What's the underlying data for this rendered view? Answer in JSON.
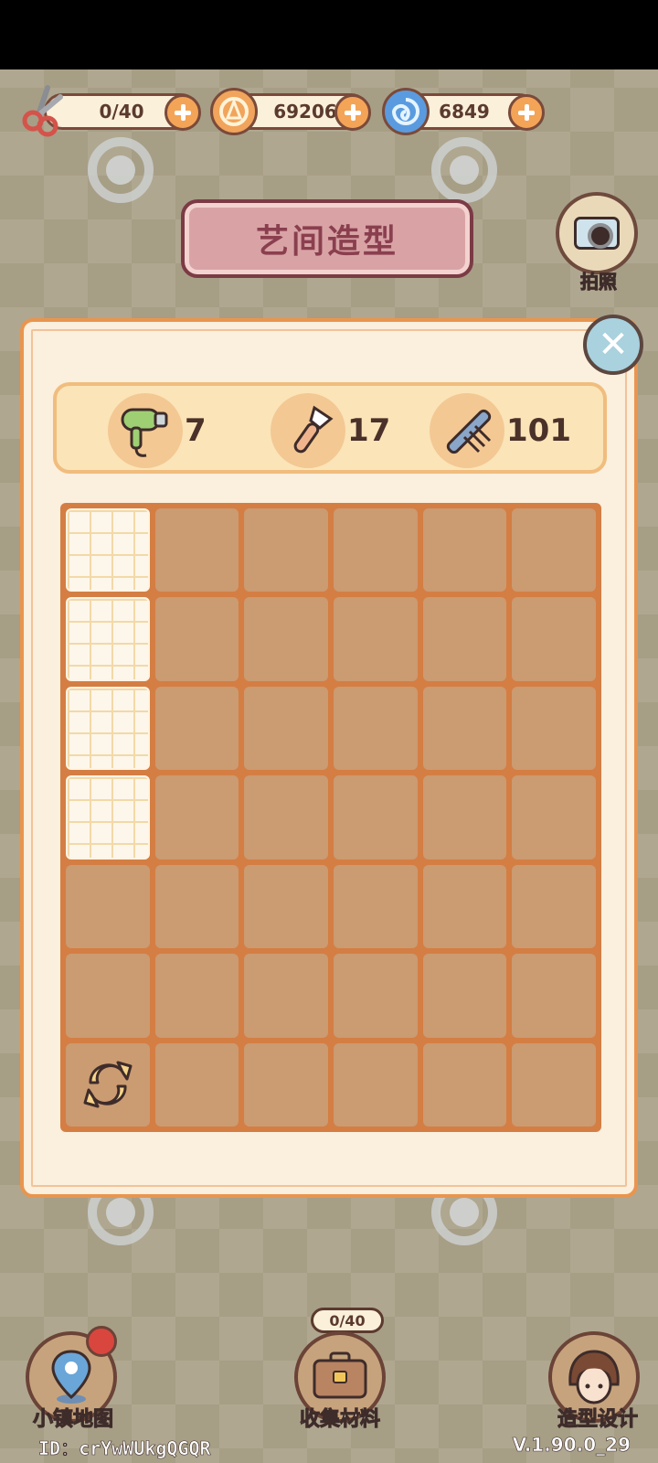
{
  "resources": {
    "scissors": {
      "icon": "scissors-icon",
      "value": "0/40"
    },
    "coins": {
      "icon": "coin-icon",
      "value": "69206"
    },
    "gems": {
      "icon": "blue-swirl-icon",
      "value": "6849"
    }
  },
  "title": "艺间造型",
  "camera": {
    "icon": "camera-icon",
    "label": "拍照"
  },
  "tools": [
    {
      "icon": "hair-dryer-icon",
      "count": "7"
    },
    {
      "icon": "makeup-brush-icon",
      "count": "17"
    },
    {
      "icon": "comb-icon",
      "count": "101"
    }
  ],
  "grid": {
    "columns": 6,
    "rows": 7,
    "unlocked_cells": 4
  },
  "nav": {
    "map": {
      "icon": "map-pin-icon",
      "label": "小镇地图"
    },
    "collect": {
      "icon": "suitcase-icon",
      "label": "收集材料",
      "progress": "0/40"
    },
    "design": {
      "icon": "character-avatar-icon",
      "label": "造型设计"
    }
  },
  "footer": {
    "id": "ID：crYwWUkgQGQR",
    "version": "V.1.90.0_29"
  },
  "colors": {
    "panel_border": "#e9954f",
    "cell": "#cb9b72",
    "title": "#8a3f4f",
    "plus": "#f3a457"
  }
}
